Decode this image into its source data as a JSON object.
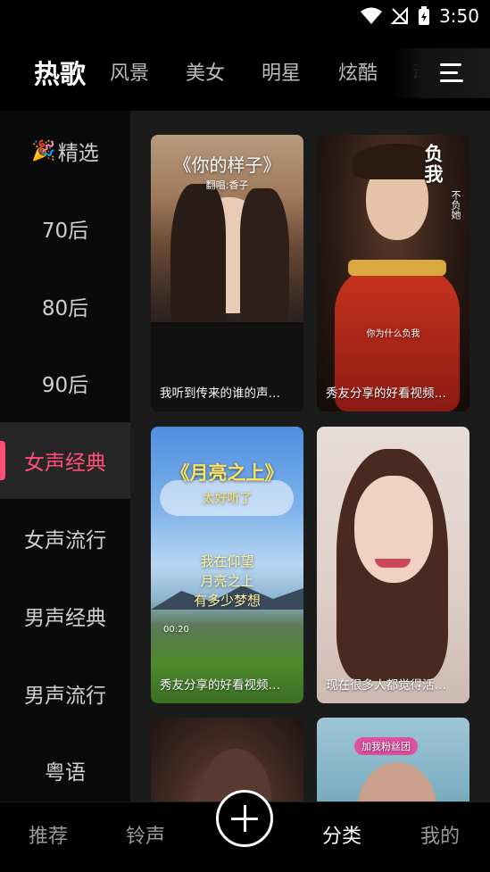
{
  "status": {
    "time": "3:50"
  },
  "top_tabs": [
    "热歌",
    "风景",
    "美女",
    "明星",
    "炫酷",
    "动"
  ],
  "sidebar": {
    "items": [
      {
        "label": "精选",
        "emoji": "🎉"
      },
      {
        "label": "70后"
      },
      {
        "label": "80后"
      },
      {
        "label": "90后"
      },
      {
        "label": "女声经典"
      },
      {
        "label": "女声流行"
      },
      {
        "label": "男声经典"
      },
      {
        "label": "男声流行"
      },
      {
        "label": "粤语"
      }
    ],
    "active": "女声经典"
  },
  "cards": [
    {
      "caption": "我听到传来的谁的声…",
      "overlay_title": "《你的样子》",
      "overlay_sub": "翻唱:香子"
    },
    {
      "caption": "秀友分享的好看视频…",
      "overlay_title": "负我",
      "overlay_side": "不负她",
      "overlay_sub": "你为什么负我"
    },
    {
      "caption": "秀友分享的好看视频…",
      "overlay_title": "《月亮之上》",
      "overlay_sub": "太好听了",
      "overlay_lines": [
        "我在仰望",
        "月亮之上",
        "有多少梦想"
      ],
      "overlay_time": "00:20"
    },
    {
      "caption": "现在很多人都觉得活…"
    },
    {
      "caption": ""
    },
    {
      "caption": "",
      "overlay_badge": "加我粉丝团"
    }
  ],
  "bottom_nav": [
    "推荐",
    "铃声",
    "分类",
    "我的"
  ],
  "colors": {
    "accent": "#ff4e78",
    "content_bg": "#1b1b1b",
    "active_side_bg": "#262626"
  }
}
